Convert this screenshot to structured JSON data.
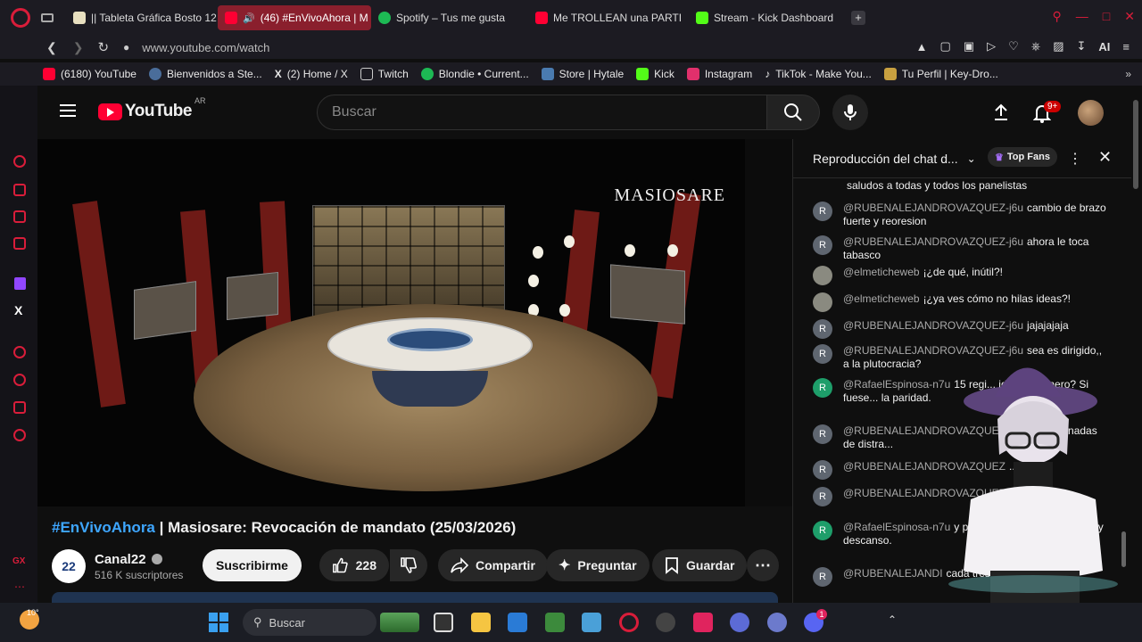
{
  "browser": {
    "tabs": [
      {
        "label": "|| Tableta Gráfica Bosto 12",
        "color": "#e8e0c0"
      },
      {
        "label": "(46) #EnVivoAhora | M",
        "color": "#ff0033"
      },
      {
        "label": "Spotify – Tus me gusta",
        "color": "#1db954"
      },
      {
        "label": "Me TROLLEAN una PARTI",
        "color": "#ff0033"
      },
      {
        "label": "Stream - Kick Dashboard",
        "color": "#53fc18"
      }
    ],
    "url": "www.youtube.com/watch",
    "ai_label": "AI",
    "bookmarks": [
      {
        "label": "(6180) YouTube",
        "color": "#ff0033"
      },
      {
        "label": "Bienvenidos a Ste...",
        "color": "#1b2838"
      },
      {
        "label": "(2) Home / X",
        "color": "#ffffff"
      },
      {
        "label": "Twitch",
        "color": "#9146ff"
      },
      {
        "label": "Blondie • Current...",
        "color": "#1db954"
      },
      {
        "label": "Store | Hytale",
        "color": "#4a7bb0"
      },
      {
        "label": "Kick",
        "color": "#53fc18"
      },
      {
        "label": "Instagram",
        "color": "#e1306c"
      },
      {
        "label": "TikTok - Make You...",
        "color": "#ffffff"
      },
      {
        "label": "Tu Perfil | Key-Dro...",
        "color": "#c8a040"
      }
    ]
  },
  "youtube": {
    "logo": "YouTube",
    "region": "AR",
    "search_placeholder": "Buscar",
    "notif_badge": "9+",
    "video": {
      "watermark": "MASIOSARE",
      "hashtag": "#EnVivoAhora",
      "title_rest": " | Masiosare: Revocación de mandato (25/03/2026)",
      "channel": "Canal22",
      "channel_avatar": "22",
      "subs": "516 K suscriptores",
      "subscribe": "Suscribirme",
      "likes": "228",
      "share": "Compartir",
      "ask": "Preguntar",
      "save": "Guardar"
    },
    "chat": {
      "header": "Reproducción del chat d...",
      "top_fans": "Top Fans",
      "first_line": "saludos a todas y todos los panelistas",
      "messages": [
        {
          "initial": "R",
          "author": "@RUBENALEJANDROVAZQUEZ-j6u",
          "text": "cambio de brazo fuerte y reoresion",
          "color": "#5f6670"
        },
        {
          "initial": "R",
          "author": "@RUBENALEJANDROVAZQUEZ-j6u",
          "text": "ahora le toca tabasco",
          "color": "#5f6670"
        },
        {
          "initial": "",
          "author": "@elmeticheweb",
          "text": "¡¿de qué, inútil?!",
          "color": "#8a8a80"
        },
        {
          "initial": "",
          "author": "@elmeticheweb",
          "text": "¡¿ya ves cómo no hilas ideas?!",
          "color": "#8a8a80"
        },
        {
          "initial": "R",
          "author": "@RUBENALEJANDROVAZQUEZ-j6u",
          "text": "jajajajaja",
          "color": "#5f6670"
        },
        {
          "initial": "R",
          "author": "@RUBENALEJANDROVAZQUEZ-j6u",
          "text": "sea es dirigido,, a la plutocracia?",
          "color": "#5f6670"
        },
        {
          "initial": "R",
          "author": "@RafaelEspinosa-n7u",
          "text": "15 regi... idad de género? Si fuese... la paridad.",
          "color": "#1e9e6a"
        },
        {
          "initial": "R",
          "author": "@RUBENALEJANDROVAZQUEZ",
          "text": "palabras manadas de distra...",
          "color": "#5f6670"
        },
        {
          "initial": "R",
          "author": "@RUBENALEJANDROVAZQUEZ",
          "text": "...ion",
          "color": "#5f6670"
        },
        {
          "initial": "R",
          "author": "@RUBENALEJANDROVAZQUEZ",
          "text": "...dras 8",
          "color": "#5f6670"
        },
        {
          "initial": "R",
          "author": "@RafaelEspinosa-n7u",
          "text": "y pertinentes análisis... noche y descanso.",
          "color": "#1e9e6a"
        },
        {
          "initial": "R",
          "author": "@RUBENALEJANDI",
          "text": "cada tres dias",
          "color": "#5f6670"
        }
      ]
    }
  },
  "taskbar": {
    "weather": "10°",
    "search_label": "Buscar",
    "notif_count": "1"
  }
}
